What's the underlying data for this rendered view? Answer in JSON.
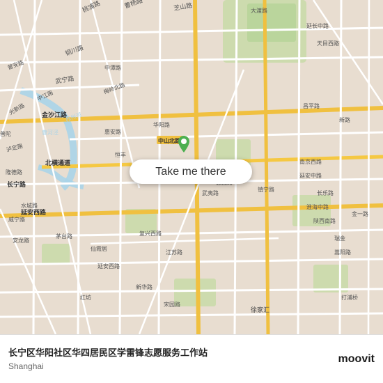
{
  "map": {
    "background_color": "#e8ddd0",
    "center_lat": 31.228,
    "center_lng": 121.435
  },
  "button": {
    "label": "Take me there"
  },
  "bottom_bar": {
    "title": "长宁区华阳社区华四居民区学雷锋志愿服务工作站",
    "subtitle": "Shanghai",
    "logo_text": "moovit",
    "logo_dot": "·"
  },
  "pin": {
    "color": "#4CAF50"
  }
}
